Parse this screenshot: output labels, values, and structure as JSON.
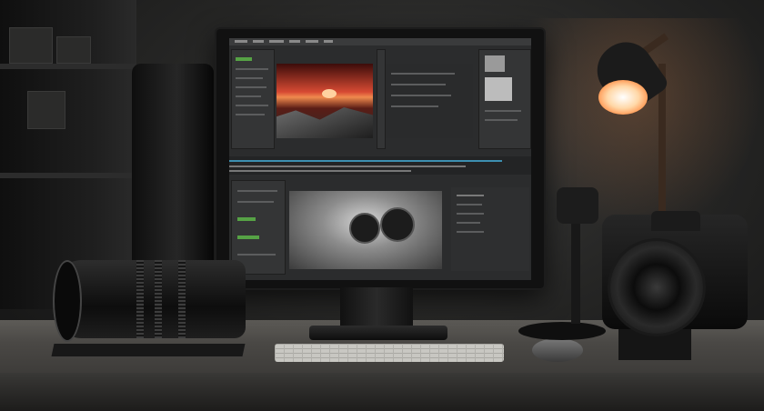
{
  "scene": {
    "kind": "photo-editing-desk",
    "colors": {
      "lamp_glow": "#ff8a40",
      "sunset": "#d64a33",
      "ui_dark": "#2b2c2d",
      "accent_green": "#56a245",
      "accent_blue": "#3d8fb0"
    }
  }
}
